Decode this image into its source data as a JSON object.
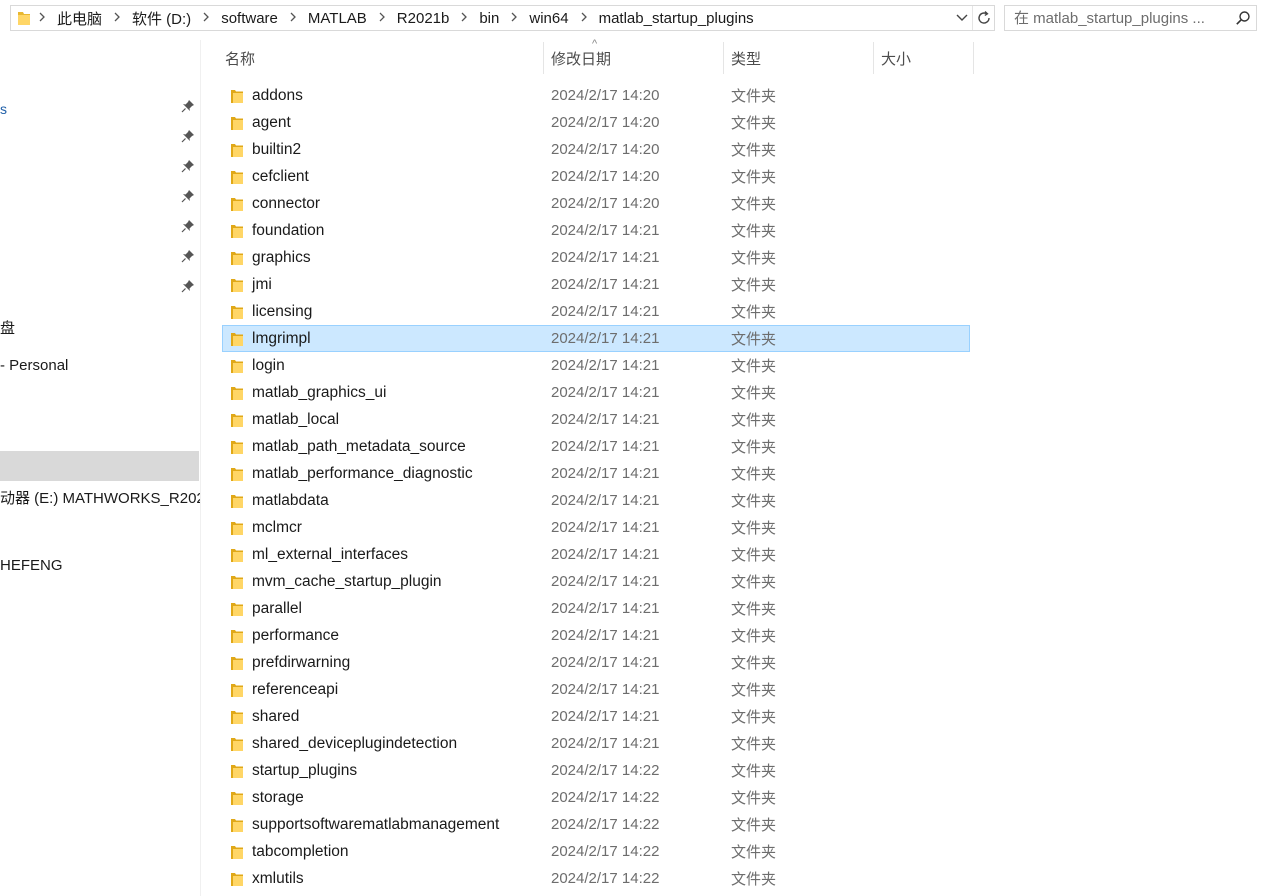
{
  "address": {
    "crumbs": [
      "此电脑",
      "软件 (D:)",
      "software",
      "MATLAB",
      "R2021b",
      "bin",
      "win64",
      "matlab_startup_plugins"
    ],
    "search_placeholder": "在 matlab_startup_plugins ..."
  },
  "nav": {
    "quick_access_mark": "s",
    "items": [
      {
        "label": "盘"
      },
      {
        "label": " - Personal"
      },
      {
        "label": "动器 (E:) MATHWORKS_R202"
      },
      {
        "label": "HEFENG"
      }
    ]
  },
  "columns": {
    "name": "名称",
    "date": "修改日期",
    "type": "类型",
    "size": "大小"
  },
  "files": [
    {
      "name": "addons",
      "date": "2024/2/17 14:20",
      "type": "文件夹",
      "size": ""
    },
    {
      "name": "agent",
      "date": "2024/2/17 14:20",
      "type": "文件夹",
      "size": ""
    },
    {
      "name": "builtin2",
      "date": "2024/2/17 14:20",
      "type": "文件夹",
      "size": ""
    },
    {
      "name": "cefclient",
      "date": "2024/2/17 14:20",
      "type": "文件夹",
      "size": ""
    },
    {
      "name": "connector",
      "date": "2024/2/17 14:20",
      "type": "文件夹",
      "size": ""
    },
    {
      "name": "foundation",
      "date": "2024/2/17 14:21",
      "type": "文件夹",
      "size": ""
    },
    {
      "name": "graphics",
      "date": "2024/2/17 14:21",
      "type": "文件夹",
      "size": ""
    },
    {
      "name": "jmi",
      "date": "2024/2/17 14:21",
      "type": "文件夹",
      "size": ""
    },
    {
      "name": "licensing",
      "date": "2024/2/17 14:21",
      "type": "文件夹",
      "size": ""
    },
    {
      "name": "lmgrimpl",
      "date": "2024/2/17 14:21",
      "type": "文件夹",
      "size": "",
      "selected": true
    },
    {
      "name": "login",
      "date": "2024/2/17 14:21",
      "type": "文件夹",
      "size": ""
    },
    {
      "name": "matlab_graphics_ui",
      "date": "2024/2/17 14:21",
      "type": "文件夹",
      "size": ""
    },
    {
      "name": "matlab_local",
      "date": "2024/2/17 14:21",
      "type": "文件夹",
      "size": ""
    },
    {
      "name": "matlab_path_metadata_source",
      "date": "2024/2/17 14:21",
      "type": "文件夹",
      "size": ""
    },
    {
      "name": "matlab_performance_diagnostic",
      "date": "2024/2/17 14:21",
      "type": "文件夹",
      "size": ""
    },
    {
      "name": "matlabdata",
      "date": "2024/2/17 14:21",
      "type": "文件夹",
      "size": ""
    },
    {
      "name": "mclmcr",
      "date": "2024/2/17 14:21",
      "type": "文件夹",
      "size": ""
    },
    {
      "name": "ml_external_interfaces",
      "date": "2024/2/17 14:21",
      "type": "文件夹",
      "size": ""
    },
    {
      "name": "mvm_cache_startup_plugin",
      "date": "2024/2/17 14:21",
      "type": "文件夹",
      "size": ""
    },
    {
      "name": "parallel",
      "date": "2024/2/17 14:21",
      "type": "文件夹",
      "size": ""
    },
    {
      "name": "performance",
      "date": "2024/2/17 14:21",
      "type": "文件夹",
      "size": ""
    },
    {
      "name": "prefdirwarning",
      "date": "2024/2/17 14:21",
      "type": "文件夹",
      "size": ""
    },
    {
      "name": "referenceapi",
      "date": "2024/2/17 14:21",
      "type": "文件夹",
      "size": ""
    },
    {
      "name": "shared",
      "date": "2024/2/17 14:21",
      "type": "文件夹",
      "size": ""
    },
    {
      "name": "shared_deviceplugindetection",
      "date": "2024/2/17 14:21",
      "type": "文件夹",
      "size": ""
    },
    {
      "name": "startup_plugins",
      "date": "2024/2/17 14:22",
      "type": "文件夹",
      "size": ""
    },
    {
      "name": "storage",
      "date": "2024/2/17 14:22",
      "type": "文件夹",
      "size": ""
    },
    {
      "name": "supportsoftwarematlabmanagement",
      "date": "2024/2/17 14:22",
      "type": "文件夹",
      "size": ""
    },
    {
      "name": "tabcompletion",
      "date": "2024/2/17 14:22",
      "type": "文件夹",
      "size": ""
    },
    {
      "name": "xmlutils",
      "date": "2024/2/17 14:22",
      "type": "文件夹",
      "size": ""
    }
  ],
  "colors": {
    "selection_bg": "#cce8ff",
    "selection_border": "#99d1ff",
    "folder_yellow": "#ffd666",
    "nav_selected_bg": "#d9d9d9"
  }
}
